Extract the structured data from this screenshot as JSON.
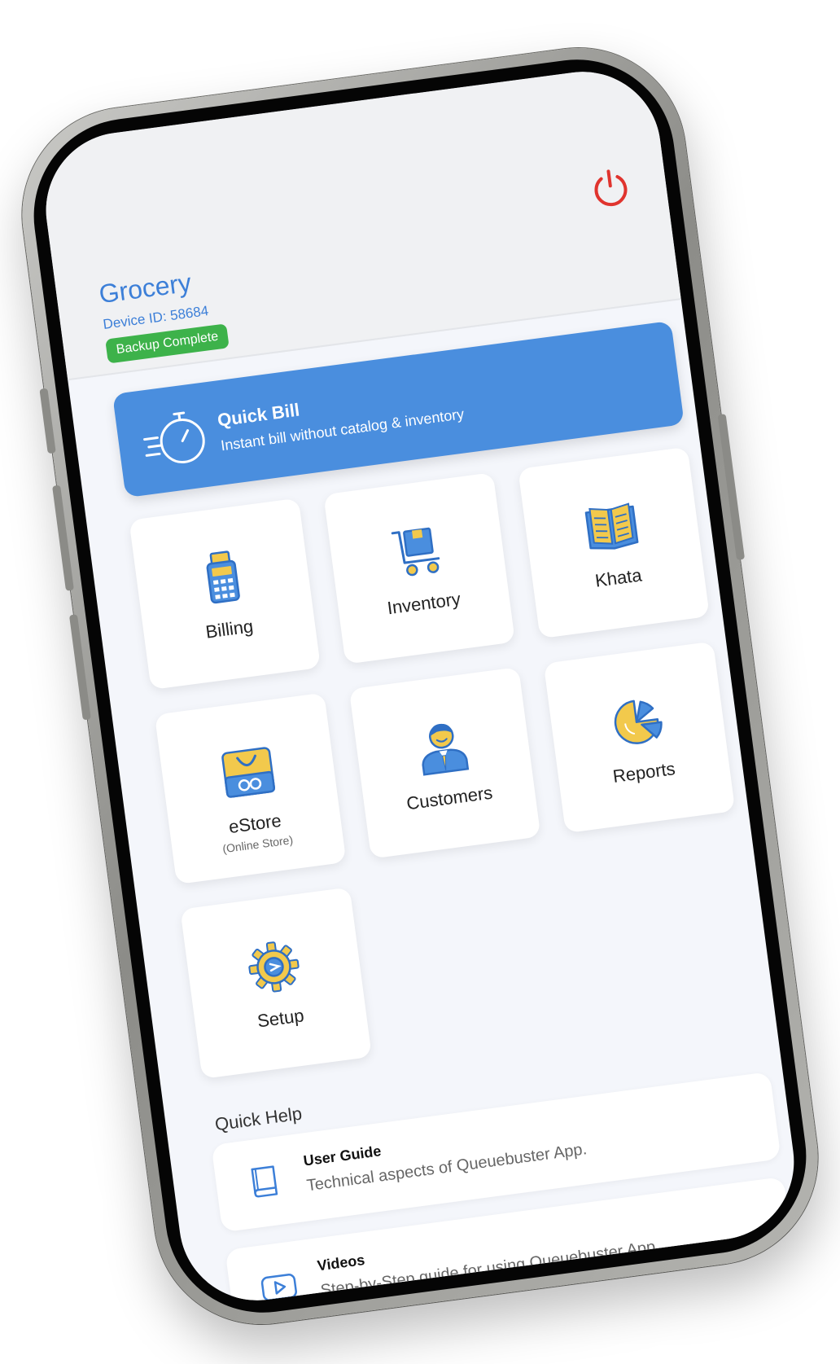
{
  "header": {
    "store_name": "Grocery",
    "device_id": "Device ID: 58684",
    "backup_status": "Backup Complete",
    "power_color": "#e0342e"
  },
  "quick_bill": {
    "title": "Quick Bill",
    "subtitle": "Instant bill without catalog & inventory"
  },
  "tiles": [
    {
      "label": "Billing",
      "icon": "pos-terminal-icon"
    },
    {
      "label": "Inventory",
      "icon": "cart-box-icon"
    },
    {
      "label": "Khata",
      "icon": "open-book-icon"
    },
    {
      "label": "eStore",
      "sublabel": "(Online Store)",
      "icon": "store-bag-icon"
    },
    {
      "label": "Customers",
      "icon": "customer-person-icon"
    },
    {
      "label": "Reports",
      "icon": "pie-chart-icon"
    },
    {
      "label": "Setup",
      "icon": "gear-icon"
    }
  ],
  "quick_help": {
    "title": "Quick Help",
    "items": [
      {
        "title": "User Guide",
        "subtitle": "Technical aspects of Queuebuster App.",
        "icon": "book-icon"
      },
      {
        "title": "Videos",
        "subtitle": "Step-by-Step guide for using Queuebuster App.",
        "icon": "play-video-icon"
      }
    ]
  },
  "colors": {
    "accent": "#4a8ede",
    "brand_text": "#3c7fd8",
    "success": "#3db24a",
    "icon_blue": "#2f6fc4",
    "icon_yellow": "#f2c94c"
  }
}
